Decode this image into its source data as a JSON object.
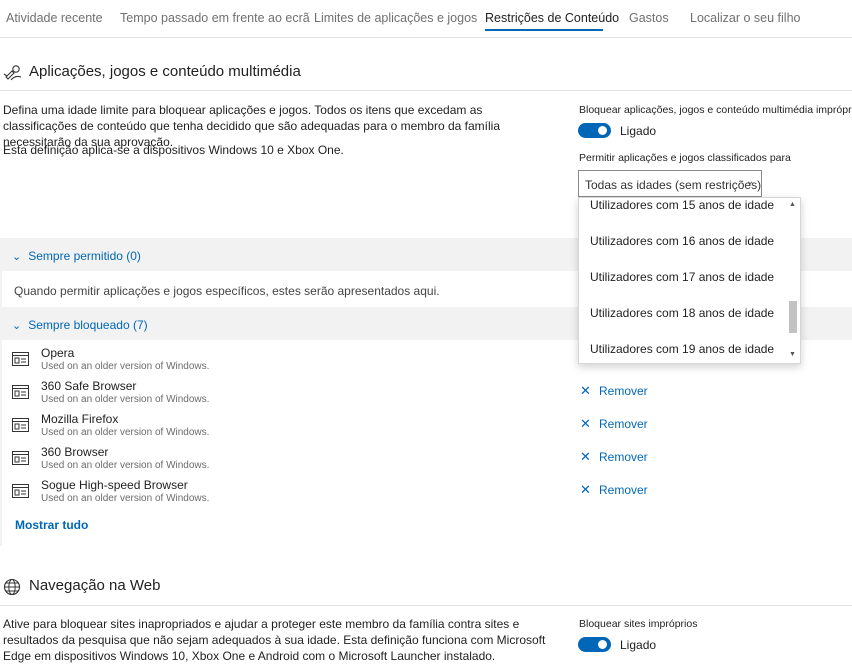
{
  "tabs": [
    {
      "label": "Atividade recente"
    },
    {
      "label": "Tempo passado em frente ao ecrã"
    },
    {
      "label": "Limites de aplicações e jogos"
    },
    {
      "label": "Restrições de Conteúdo"
    },
    {
      "label": "Gastos"
    },
    {
      "label": "Localizar o seu filho"
    }
  ],
  "active_tab": "Restrições de Conteúdo",
  "accent_color": "#0067b8",
  "apps_section": {
    "title": "Aplicações, jogos e conteúdo multimédia",
    "icon": "apps-games-icon",
    "description": "Defina uma idade limite para bloquear aplicações e jogos. Todos os itens que excedam as classificações de conteúdo que tenha decidido que são adequadas para o membro da família necessitarão da sua aprovação.",
    "note": "Esta definição aplica-se a dispositivos Windows 10 e Xbox One.",
    "block_label": "Bloquear aplicações, jogos e conteúdo multimédia impróprios",
    "toggle_state": "Ligado",
    "age_label": "Permitir aplicações e jogos classificados para",
    "age_select_value": "Todas as idades (sem restrições)",
    "age_options_visible": [
      "Utilizadores com 15 anos de idade",
      "Utilizadores com 16 anos de idade",
      "Utilizadores com 17 anos de idade",
      "Utilizadores com 18 anos de idade",
      "Utilizadores com 19 anos de idade"
    ],
    "always_allowed": {
      "header": "Sempre permitido (0)",
      "empty_text": "Quando permitir aplicações e jogos específicos, estes serão apresentados aqui."
    },
    "always_blocked": {
      "header": "Sempre bloqueado (7)",
      "items": [
        {
          "name": "Opera",
          "subtitle": "Used on an older version of Windows."
        },
        {
          "name": "360 Safe Browser",
          "subtitle": "Used on an older version of Windows.",
          "action": "Remover"
        },
        {
          "name": "Mozilla Firefox",
          "subtitle": "Used on an older version of Windows.",
          "action": "Remover"
        },
        {
          "name": "360 Browser",
          "subtitle": "Used on an older version of Windows.",
          "action": "Remover"
        },
        {
          "name": "Sogue High-speed Browser",
          "subtitle": "Used on an older version of Windows.",
          "action": "Remover"
        }
      ],
      "show_all": "Mostrar tudo"
    }
  },
  "web_section": {
    "title": "Navegação na Web",
    "icon": "globe-icon",
    "description": "Ative para bloquear sites inapropriados e ajudar a proteger este membro da família contra sites e resultados da pesquisa que não sejam adequados à sua idade. Esta definição funciona com Microsoft Edge em dispositivos Windows 10, Xbox One e Android com o Microsoft Launcher instalado.",
    "block_label": "Bloquear sites impróprios",
    "toggle_state": "Ligado"
  }
}
